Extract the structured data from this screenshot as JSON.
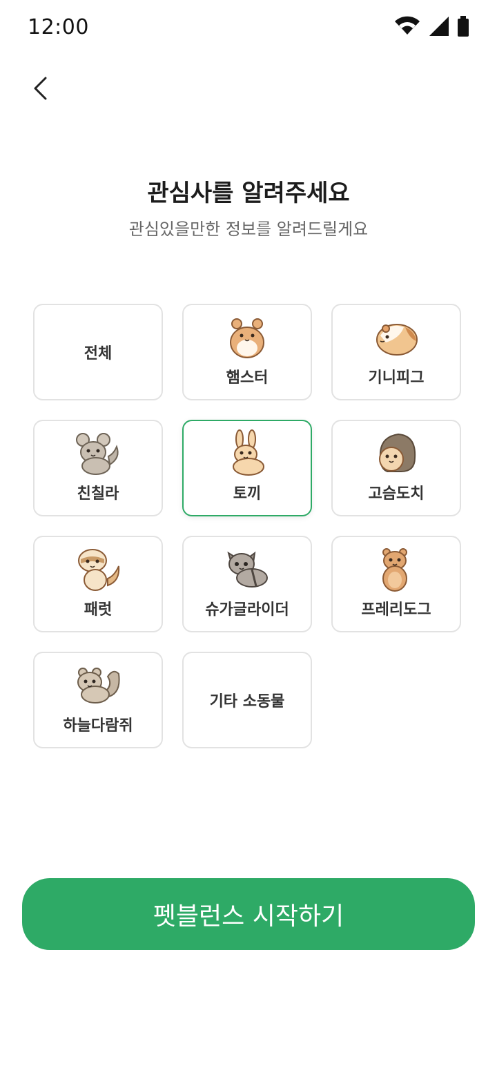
{
  "status_bar": {
    "time": "12:00"
  },
  "header": {
    "back_icon": "chevron-left-icon"
  },
  "title": "관심사를 알려주세요",
  "subtitle": "관심있을만한 정보를 알려드릴게요",
  "options": [
    {
      "id": "all",
      "label": "전체",
      "icon": null,
      "selected": false
    },
    {
      "id": "hamster",
      "label": "햄스터",
      "icon": "hamster-icon",
      "selected": false
    },
    {
      "id": "guinea-pig",
      "label": "기니피그",
      "icon": "guinea-pig-icon",
      "selected": false
    },
    {
      "id": "chinchilla",
      "label": "친칠라",
      "icon": "chinchilla-icon",
      "selected": false
    },
    {
      "id": "rabbit",
      "label": "토끼",
      "icon": "rabbit-icon",
      "selected": true
    },
    {
      "id": "hedgehog",
      "label": "고슴도치",
      "icon": "hedgehog-icon",
      "selected": false
    },
    {
      "id": "ferret",
      "label": "패럿",
      "icon": "ferret-icon",
      "selected": false
    },
    {
      "id": "sugar-glider",
      "label": "슈가글라이더",
      "icon": "sugar-glider-icon",
      "selected": false
    },
    {
      "id": "prairie-dog",
      "label": "프레리도그",
      "icon": "prairie-dog-icon",
      "selected": false
    },
    {
      "id": "flying-squirrel",
      "label": "하늘다람쥐",
      "icon": "flying-squirrel-icon",
      "selected": false
    },
    {
      "id": "other",
      "label": "기타 소동물",
      "icon": null,
      "selected": false
    }
  ],
  "cta": {
    "label": "펫블런스 시작하기",
    "color": "#2eaa66"
  },
  "colors": {
    "accent": "#2eaa66",
    "border": "#e2e2e2",
    "text": "#333333",
    "subtext": "#666666"
  }
}
